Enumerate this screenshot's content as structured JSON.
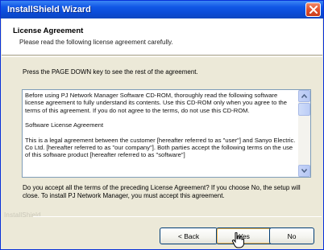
{
  "window": {
    "title": "InstallShield Wizard"
  },
  "header": {
    "title": "License Agreement",
    "subtitle": "Please read the following license agreement carefully."
  },
  "instruction": "Press the PAGE DOWN key to see the rest of the agreement.",
  "license": {
    "paragraphs": [
      "Before using PJ Network Manager Software CD-ROM, thoroughly read the following software license agreement to fully understand its contents. Use this CD-ROM only when you agree to the terms of this agreement. If you do not agree to the terms, do not use this CD-ROM.",
      "Software License Agreement",
      "This is a legal agreement between the customer [hereafter referred to as \"user\"] and Sanyo Electric. Co Ltd. [hereafter referred to as \"our company\"]. Both parties accept the following terms on the use of this software product [hereafter referred to as \"software\"]"
    ]
  },
  "question": "Do you accept all the terms of the preceding License Agreement? If you choose No, the setup will close. To install PJ Network Manager, you must accept this agreement.",
  "brand": "InstallShield",
  "buttons": {
    "back": "< Back",
    "yes": "Yes",
    "no": "No"
  },
  "icons": {
    "close": "close-icon",
    "scroll_up": "arrow-up-icon",
    "scroll_down": "arrow-down-icon",
    "cursor": "mouse-cursor-icon"
  }
}
